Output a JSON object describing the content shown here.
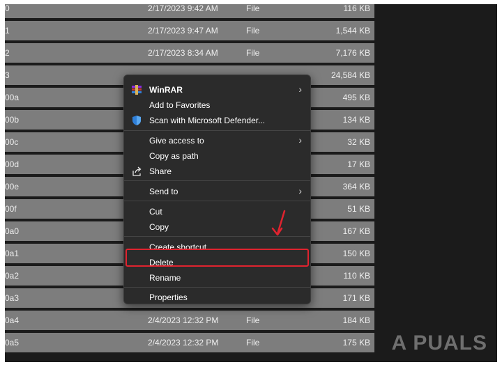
{
  "file_list": {
    "rows": [
      {
        "name": "0",
        "date": "2/17/2023 9:42 AM",
        "type": "File",
        "size": "116 KB"
      },
      {
        "name": "1",
        "date": "2/17/2023 9:47 AM",
        "type": "File",
        "size": "1,544 KB"
      },
      {
        "name": "2",
        "date": "2/17/2023 8:34 AM",
        "type": "File",
        "size": "7,176 KB"
      },
      {
        "name": "3",
        "date": "",
        "type": "",
        "size": "24,584 KB"
      },
      {
        "name": "00a",
        "date": "",
        "type": "",
        "size": "495 KB"
      },
      {
        "name": "00b",
        "date": "",
        "type": "",
        "size": "134 KB"
      },
      {
        "name": "00c",
        "date": "",
        "type": "",
        "size": "32 KB"
      },
      {
        "name": "00d",
        "date": "",
        "type": "",
        "size": "17 KB"
      },
      {
        "name": "00e",
        "date": "",
        "type": "",
        "size": "364 KB"
      },
      {
        "name": "00f",
        "date": "",
        "type": "",
        "size": "51 KB"
      },
      {
        "name": "0a0",
        "date": "",
        "type": "",
        "size": "167 KB"
      },
      {
        "name": "0a1",
        "date": "",
        "type": "",
        "size": "150 KB"
      },
      {
        "name": "0a2",
        "date": "",
        "type": "",
        "size": "110 KB"
      },
      {
        "name": "0a3",
        "date": "",
        "type": "",
        "size": "171 KB"
      },
      {
        "name": "0a4",
        "date": "2/4/2023 12:32 PM",
        "type": "File",
        "size": "184 KB"
      },
      {
        "name": "0a5",
        "date": "2/4/2023 12:32 PM",
        "type": "File",
        "size": "175 KB"
      }
    ]
  },
  "context_menu": {
    "winrar": "WinRAR",
    "add_to_favorites": "Add to Favorites",
    "scan_defender": "Scan with Microsoft Defender...",
    "give_access": "Give access to",
    "copy_as_path": "Copy as path",
    "share": "Share",
    "send_to": "Send to",
    "cut": "Cut",
    "copy": "Copy",
    "create_shortcut": "Create shortcut",
    "delete": "Delete",
    "rename": "Rename",
    "properties": "Properties",
    "submenu_chevron": "›"
  },
  "icons": {
    "winrar": "winrar-icon",
    "defender": "defender-shield-icon",
    "share": "share-icon",
    "arrow": "red-arrow-annotation"
  },
  "colors": {
    "highlight": "#e0232f",
    "menu_bg": "#2b2b2b",
    "row_bg": "#7d7d7d"
  },
  "watermark": "A PUALS"
}
